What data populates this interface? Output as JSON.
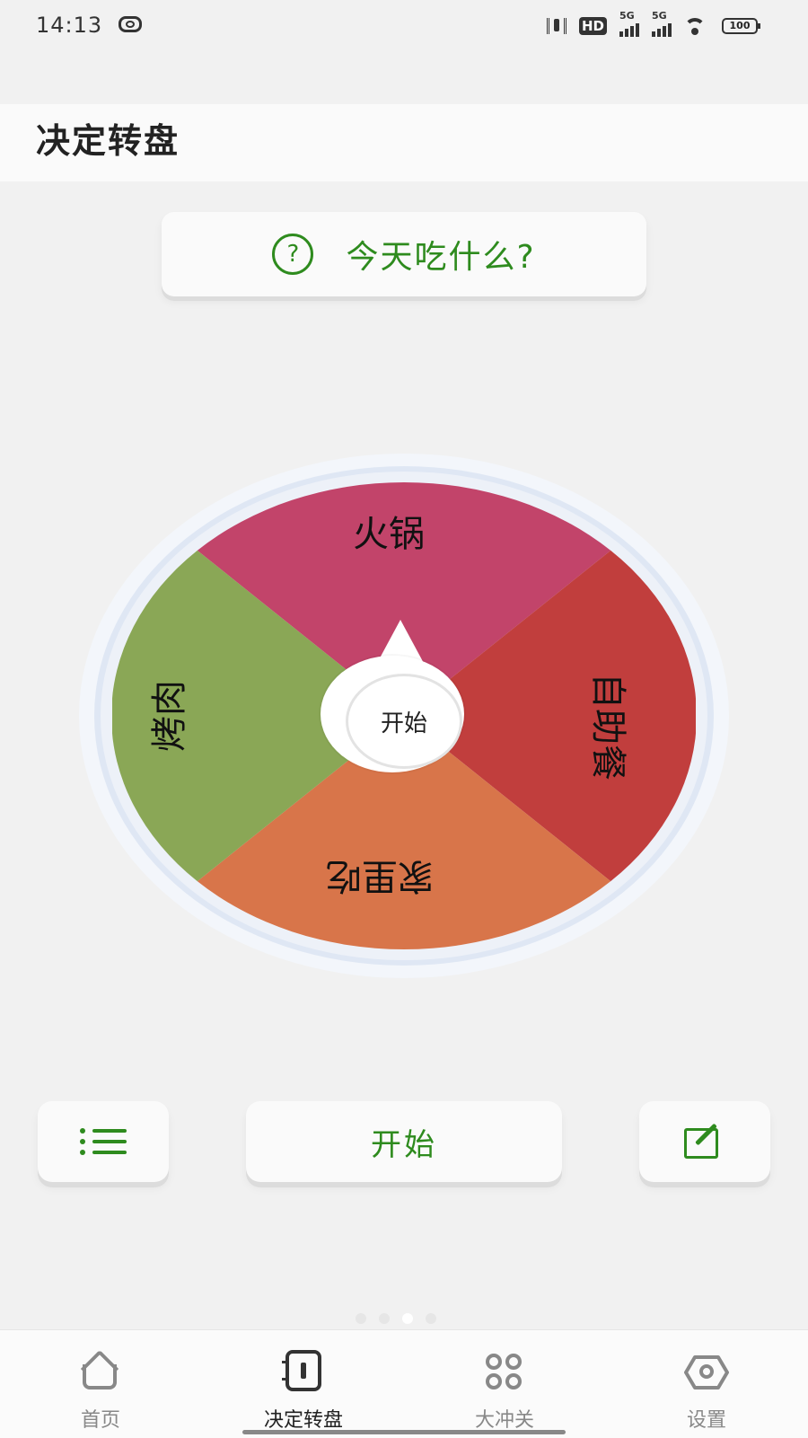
{
  "status_bar": {
    "time": "14:13",
    "hd": "HD",
    "net1": "5G",
    "net2": "5G",
    "battery": "100"
  },
  "app_bar": {
    "title": "决定转盘"
  },
  "question": {
    "icon": "question-circle-icon",
    "glyph": "?",
    "text": "今天吃什么?"
  },
  "wheel": {
    "segments": [
      {
        "label": "火锅",
        "color": "#c2446a"
      },
      {
        "label": "自助餐",
        "color": "#c13e3d"
      },
      {
        "label": "家里吃",
        "color": "#d8754a"
      },
      {
        "label": "烤肉",
        "color": "#8aa756"
      }
    ],
    "hub_label": "开始",
    "rim_color": "#e4ebf6"
  },
  "controls": {
    "list_icon": "list-icon",
    "start_label": "开始",
    "edit_icon": "edit-icon",
    "accent": "#2e8b1e"
  },
  "page_dots": {
    "count": 4,
    "active": 2
  },
  "bottom_nav": {
    "items": [
      {
        "label": "首页",
        "icon": "home-icon",
        "active": false
      },
      {
        "label": "决定转盘",
        "icon": "notebook-icon",
        "active": true
      },
      {
        "label": "大冲关",
        "icon": "grid-icon",
        "active": false
      },
      {
        "label": "设置",
        "icon": "settings-icon",
        "active": false
      }
    ]
  }
}
